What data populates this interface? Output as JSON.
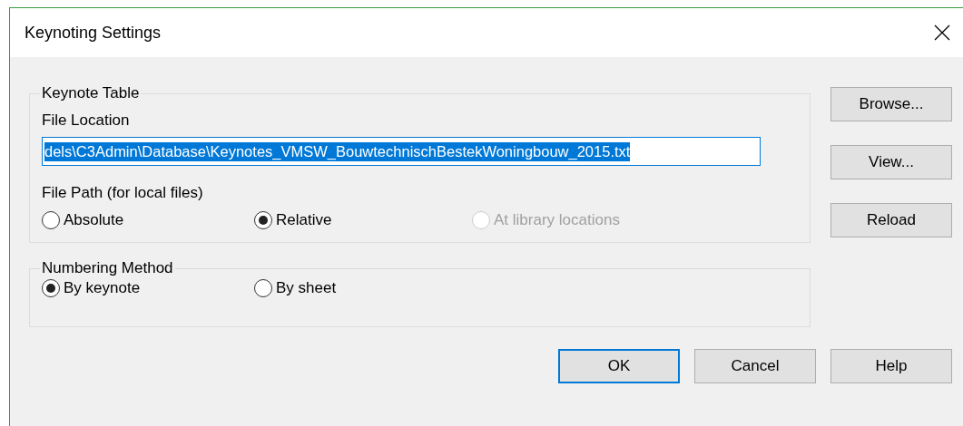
{
  "window": {
    "title": "Keynoting Settings"
  },
  "keynote_table": {
    "title": "Keynote Table",
    "file_location_label": "File Location",
    "file_location": {
      "value": "dels\\C3Admin\\Database\\Keynotes_VMSW_BouwtechnischBestekWoningbouw_2015.txt",
      "selected": true
    },
    "file_path_label": "File Path (for local files)",
    "file_path_options": [
      {
        "label": "Absolute",
        "selected": false,
        "disabled": false
      },
      {
        "label": "Relative",
        "selected": true,
        "disabled": false
      },
      {
        "label": "At library locations",
        "selected": false,
        "disabled": true
      }
    ]
  },
  "numbering_method": {
    "title": "Numbering Method",
    "options": [
      {
        "label": "By keynote",
        "selected": true
      },
      {
        "label": "By sheet",
        "selected": false
      }
    ]
  },
  "side_buttons": [
    "Browse...",
    "View...",
    "Reload"
  ],
  "buttons": [
    {
      "label": "OK",
      "default": true
    },
    {
      "label": "Cancel",
      "default": false
    },
    {
      "label": "Help",
      "default": false
    }
  ]
}
